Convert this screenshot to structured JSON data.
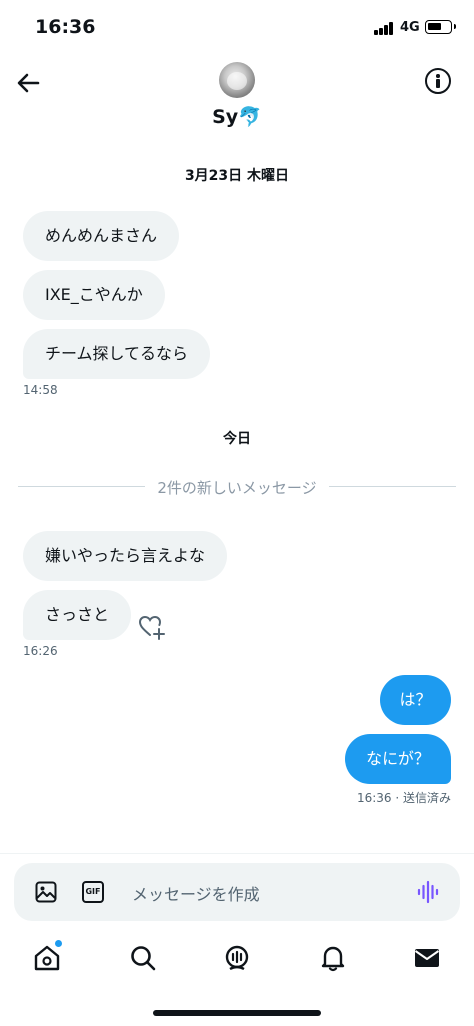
{
  "status": {
    "time": "16:36",
    "network": "4G"
  },
  "header": {
    "name": "Sy🐬"
  },
  "dates": {
    "first": "3月23日 木曜日",
    "today": "今日"
  },
  "unread_divider": "2件の新しいメッセージ",
  "messages_day1": [
    "めんめんまさん",
    "IXE_こやんか",
    "チーム探してるなら"
  ],
  "time_day1": "14:58",
  "messages_today_in": [
    "嫌いやったら言えよな",
    "さっさと"
  ],
  "time_today_in": "16:26",
  "messages_today_out": [
    "は？",
    "なにが？"
  ],
  "time_today_out": "16:36 · 送信済み",
  "composer": {
    "placeholder": "メッセージを作成",
    "gif_label": "GIF"
  },
  "colors": {
    "accent": "#1d9bf0",
    "incoming_bubble": "#eff3f4",
    "voice_icon": "#7856ff"
  },
  "icons": [
    "back-arrow-icon",
    "info-icon",
    "heart-plus-icon",
    "image-icon",
    "gif-icon",
    "voice-icon",
    "home-icon",
    "search-icon",
    "spaces-icon",
    "bell-icon",
    "mail-icon"
  ]
}
